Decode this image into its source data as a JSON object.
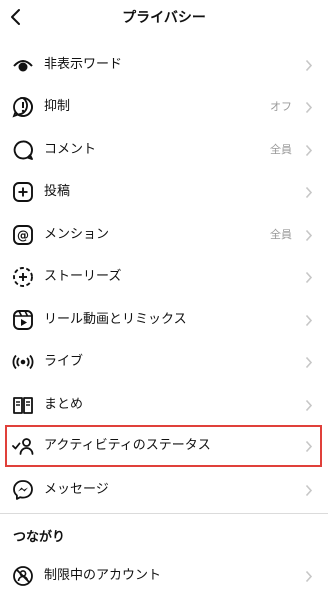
{
  "header": {
    "title": "プライバシー"
  },
  "menu": {
    "items": [
      {
        "label": "非表示ワード",
        "value": "",
        "icon": "eye-slash-icon"
      },
      {
        "label": "抑制",
        "value": "オフ",
        "icon": "limit-alert-icon"
      },
      {
        "label": "コメント",
        "value": "全員",
        "icon": "comment-bubble-icon"
      },
      {
        "label": "投稿",
        "value": "",
        "icon": "plus-square-icon"
      },
      {
        "label": "メンション",
        "value": "全員",
        "icon": "at-sign-icon"
      },
      {
        "label": "ストーリーズ",
        "value": "",
        "icon": "story-plus-icon"
      },
      {
        "label": "リール動画とリミックス",
        "value": "",
        "icon": "reels-icon"
      },
      {
        "label": "ライブ",
        "value": "",
        "icon": "live-broadcast-icon"
      },
      {
        "label": "まとめ",
        "value": "",
        "icon": "guide-book-icon"
      },
      {
        "label": "アクティビティのステータス",
        "value": "",
        "icon": "activity-status-icon"
      },
      {
        "label": "メッセージ",
        "value": "",
        "icon": "messenger-icon"
      }
    ]
  },
  "connections": {
    "heading": "つながり",
    "items": [
      {
        "label": "制限中のアカウント",
        "value": "",
        "icon": "restricted-account-icon"
      }
    ]
  },
  "colors": {
    "highlight": "#e0403a",
    "secondary_text": "#9a9a9a",
    "chevron": "#c7c7c7"
  }
}
